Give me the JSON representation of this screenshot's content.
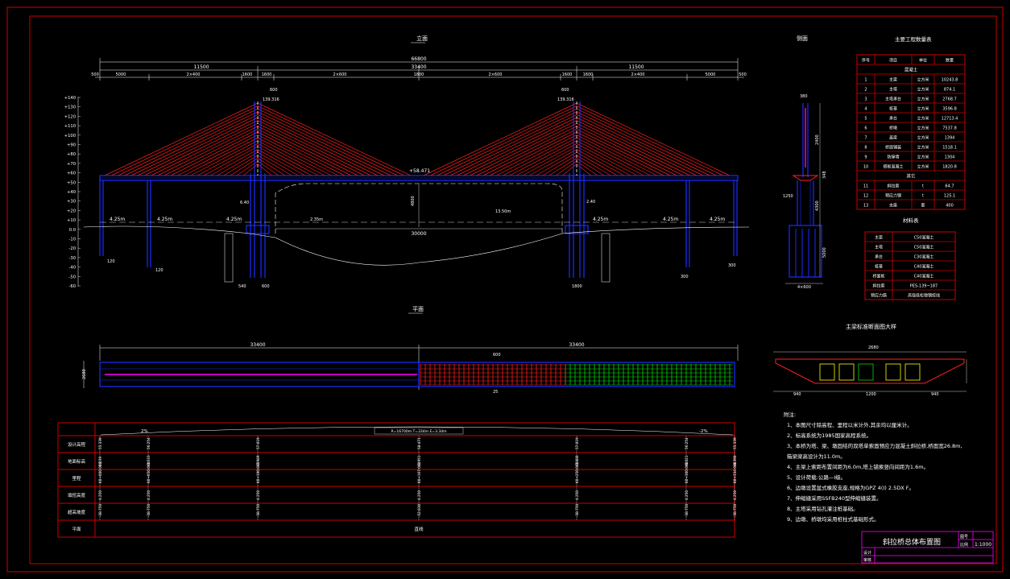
{
  "views": {
    "elevation_title": "立面",
    "plan_title": "平面",
    "side_title": "侧面",
    "section_title": "主梁标准断面图大样"
  },
  "dimensions": {
    "total": "66800",
    "half_left": "33400",
    "half_right": "33400",
    "side_spans": [
      "11500",
      "11500"
    ],
    "center": "1800",
    "segments": [
      "500",
      "5000",
      "2×400",
      "1600",
      "1600",
      "2×600",
      "2×600",
      "1600",
      "1600",
      "2×400",
      "5000",
      "500"
    ],
    "tower_width_top": "600",
    "tower_elev_left": "139.316",
    "tower_elev_right": "139.316",
    "deck_elev": "+58.471",
    "main_span_depth": "4800",
    "main_span": "30000",
    "water_left": "4.25m",
    "water_right": "4.25m",
    "pile_labels": [
      "120",
      "120",
      "540",
      "600",
      "1800",
      "300",
      "300"
    ],
    "slope_left": "2.35m",
    "slope_right": "13.50m",
    "pier_left": "6.40",
    "pier_right": "2.40",
    "plan_left": "33400",
    "plan_right": "33400",
    "plan_mid": "600",
    "plan_width": "2680",
    "plan_bottom": "25",
    "side_dims": [
      "380",
      "2400",
      "348",
      "1250",
      "4300",
      "5000",
      "4×600"
    ],
    "section_dims": [
      "2680",
      "940",
      "1200",
      "940"
    ]
  },
  "y_axis_labels": [
    "+140",
    "+130",
    "+120",
    "+110",
    "+100",
    "+90",
    "+80",
    "+70",
    "+60",
    "+50",
    "+40",
    "+30",
    "+20",
    "+10",
    "0.0",
    "-10",
    "-20",
    "-30",
    "-40",
    "-50",
    "-60"
  ],
  "quantities_table": {
    "title": "主要工程数量表",
    "headers": [
      "序号",
      "项目",
      "单位",
      "数量"
    ],
    "group1": "混凝土",
    "rows": [
      [
        "1",
        "主梁",
        "立方米",
        "10243.8"
      ],
      [
        "2",
        "主塔",
        "立方米",
        "874.1"
      ],
      [
        "3",
        "主塔承台",
        "立方米",
        "2768.7"
      ],
      [
        "4",
        "桩基",
        "立方米",
        "3596.8"
      ],
      [
        "5",
        "承台",
        "立方米",
        "12713.4"
      ],
      [
        "6",
        "桥墩",
        "立方米",
        "7537.8"
      ],
      [
        "7",
        "盖梁",
        "立方米",
        "1394"
      ],
      [
        "8",
        "桥面铺装",
        "立方米",
        "1518.1"
      ],
      [
        "9",
        "防撞墙",
        "立方米",
        "1304"
      ],
      [
        "10",
        "搭板混凝土",
        "立方米",
        "1820.8"
      ]
    ],
    "group2": "其它",
    "rows2": [
      [
        "11",
        "斜拉索",
        "t",
        "64.7"
      ],
      [
        "12",
        "预应力钢",
        "t",
        "125.1"
      ],
      [
        "13",
        "支座",
        "套",
        "400"
      ]
    ]
  },
  "materials_table": {
    "title": "材料表",
    "rows": [
      [
        "主梁",
        "C50混凝土"
      ],
      [
        "主塔",
        "C50混凝土"
      ],
      [
        "承台",
        "C30混凝土"
      ],
      [
        "桩基",
        "C40混凝土"
      ],
      [
        "桥面板",
        "C40混凝土"
      ],
      [
        "斜拉索",
        "PES-139~187"
      ],
      [
        "预应力筋",
        "高强低松弛钢绞线"
      ]
    ]
  },
  "profile_table": {
    "rows": [
      "设计高程",
      "地面标高",
      "里程",
      "填挖高度",
      "超高坡度",
      "平面"
    ],
    "slope_left": "2%",
    "slope_right": "-2%",
    "curve": "R=16700m T=334m E=3.34m",
    "design_values": [
      "55.339",
      "56.254",
      "57.019",
      "58.471",
      "57.019",
      "56.254",
      "55.339"
    ],
    "ground_values": [
      "0.039",
      "-3.633",
      "-7.989",
      "-1.951",
      "-3.880",
      "-6.021",
      "-0.390"
    ],
    "mileage": [
      "K0+\n000.000",
      "K0+\n050.000",
      "K0+\n100.000",
      "K0+\n167.000",
      "K0+\n250.000",
      "K0+\n300.000",
      "K0+\n334.000"
    ],
    "fill": [
      "4.250",
      "4.250",
      "4.250",
      "4.250",
      "4.250",
      "4.250",
      "4.250"
    ],
    "super": [
      "-38.750",
      "-38.750",
      "-38.750",
      "-52.830",
      "-38.750",
      "-38.750",
      "-38.750"
    ],
    "plan_value": "直线"
  },
  "notes": {
    "title": "附注:",
    "items": [
      "1、本图尺寸除高程、里程以米计外,其余均以厘米计。",
      "2、标高系统为1985国家高程系统。",
      "3、本桥为塔、梁、墩固结的双塔单索面预应力混凝土斜拉桥,桥面宽26.8m,",
      "   箱梁梁高设计为11.0m。",
      "4、主梁上索距布置间距为6.0m,塔上锚索竖向间距为1.6m。",
      "5、设计荷载:公路—I级。",
      "6、边墩设置盆式橡胶支座,规格为GPZ 4(I) 2.5DX F。",
      "7、伸缩缝采用SSFB240型伸缩缝装置。",
      "8、主塔采用钻孔灌注桩基础。",
      "9、边墩、桥墩均采用桩柱式基础形式。"
    ]
  },
  "title_block": {
    "title": "斜拉桥总体布置图",
    "label_drawing_no": "图号",
    "label_scale": "比例",
    "scale": "1:1000",
    "label_design": "设计",
    "label_review": "审核"
  },
  "colors": {
    "frame": "#cc0000",
    "deck": "#1c2cff",
    "cable": "#ff2020",
    "text": "#ffffff",
    "green": "#00dd00",
    "magenta": "#ff00ff",
    "yellow": "#ffff00"
  }
}
